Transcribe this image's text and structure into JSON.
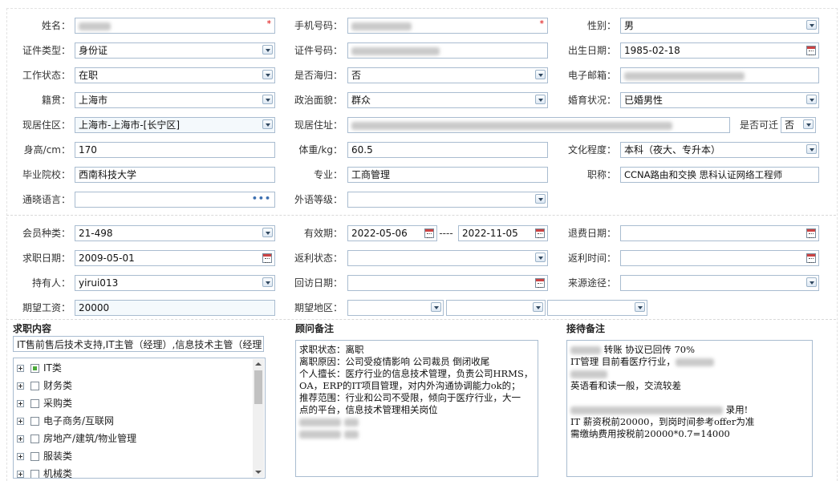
{
  "section1": {
    "name": {
      "label": "姓名：",
      "required": "*"
    },
    "phone": {
      "label": "手机号码：",
      "required": "*"
    },
    "gender": {
      "label": "性别：",
      "value": "男"
    },
    "id_type": {
      "label": "证件类型：",
      "value": "身份证"
    },
    "id_no": {
      "label": "证件号码："
    },
    "birth": {
      "label": "出生日期：",
      "value": "1985-02-18"
    },
    "work_status": {
      "label": "工作状态：",
      "value": "在职"
    },
    "overseas": {
      "label": "是否海归：",
      "value": "否"
    },
    "email": {
      "label": "电子邮箱："
    },
    "native": {
      "label": "籍贯：",
      "value": "上海市"
    },
    "political": {
      "label": "政治面貌：",
      "value": "群众"
    },
    "marital": {
      "label": "婚育状况：",
      "value": "已婚男性"
    },
    "district": {
      "label": "现居住区：",
      "value": "上海市-上海市-[长宁区]"
    },
    "address": {
      "label": "现居住址："
    },
    "relocate": {
      "label": "是否可迁",
      "value": "否"
    },
    "height": {
      "label": "身高/cm：",
      "value": "170"
    },
    "weight": {
      "label": "体重/kg：",
      "value": "60.5"
    },
    "education": {
      "label": "文化程度：",
      "value": "本科（夜大、专升本）"
    },
    "school": {
      "label": "毕业院校：",
      "value": "西南科技大学"
    },
    "major": {
      "label": "专业：",
      "value": "工商管理"
    },
    "title": {
      "label": "职称：",
      "value": "CCNA路由和交换 思科认证网络工程师"
    },
    "language": {
      "label": "通晓语言：",
      "more": "•••"
    },
    "lang_level": {
      "label": "外语等级："
    }
  },
  "section2": {
    "member_type": {
      "label": "会员种类：",
      "value": "21-498"
    },
    "validity": {
      "label": "有效期：",
      "from": "2022-05-06",
      "sep": "----",
      "to": "2022-11-05"
    },
    "refund_date": {
      "label": "退费日期："
    },
    "job_date": {
      "label": "求职日期：",
      "value": "2009-05-01"
    },
    "rebate_status": {
      "label": "返利状态："
    },
    "rebate_time": {
      "label": "返利时间："
    },
    "holder": {
      "label": "持有人：",
      "value": "yirui013"
    },
    "revisit_date": {
      "label": "回访日期："
    },
    "source": {
      "label": "来源途径："
    },
    "salary": {
      "label": "期望工资：",
      "value": "20000"
    },
    "region": {
      "label": "期望地区："
    }
  },
  "job_content": {
    "title": "求职内容",
    "summary": "IT售前售后技术支持,IT主管（经理）,信息技术主管（经理",
    "tree": [
      "IT类",
      "财务类",
      "采购类",
      "电子商务/互联网",
      "房地产/建筑/物业管理",
      "服装类",
      "机械类"
    ]
  },
  "advisor_note": {
    "title": "顾问备注",
    "lines": [
      "求职状态：离职",
      "离职原因：公司受疫情影响 公司裁员 倒闭收尾",
      "个人擅长：医疗行业的信息技术管理，负责公司HRMS，",
      "OA，ERP的IT项目管理，对内外沟通协调能力ok的；",
      "推荐范围：行业和公司不受限，倾向于医疗行业，大一",
      "点的平台，信息技术管理相关岗位"
    ]
  },
  "reception_note": {
    "title": "接待备注",
    "line1": "转账 协议已回传 70%",
    "line2": "IT管理 目前看医疗行业，",
    "line3": "英语看和读一般，交流较差",
    "line4": "录用!",
    "line5": "IT 薪资税前20000，到岗时间参考offer为准",
    "line6": "需缴纳费用按税前20000*0.7=14000"
  },
  "colors": {
    "border": "#a9bcd0",
    "required": "#dd0000",
    "check_partial": "#4caa3a"
  }
}
